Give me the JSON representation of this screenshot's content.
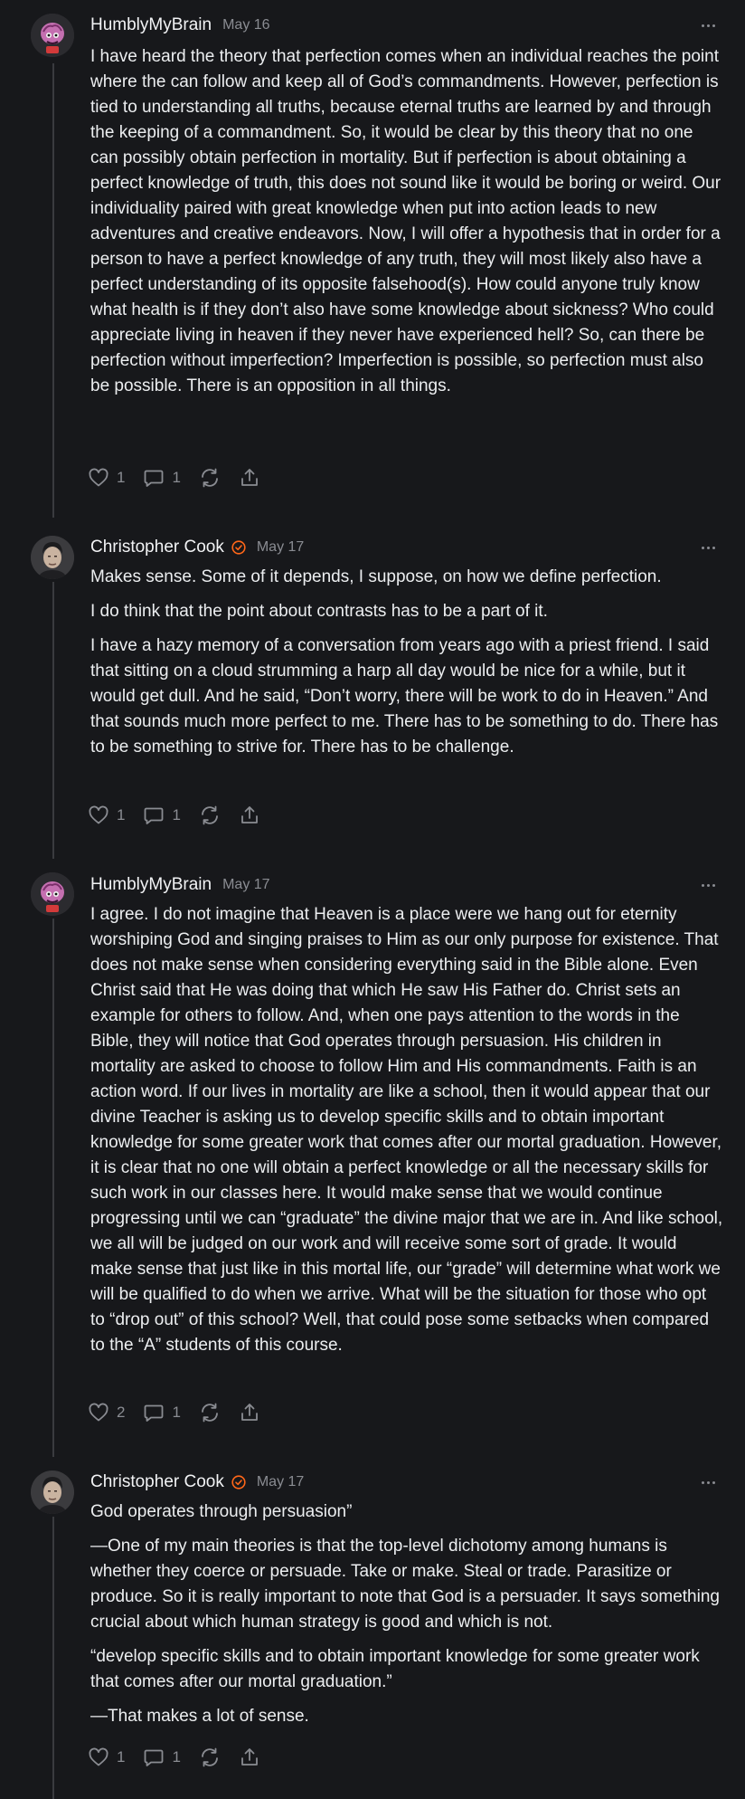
{
  "comments": [
    {
      "author": "HumblyMyBrain",
      "date": "May 16",
      "verified": false,
      "paragraphs": [
        "I have heard the theory that perfection comes when an individual reaches the point where the can follow and keep all of God’s commandments. However, perfection is tied to understanding all truths, because eternal truths are learned by and through the keeping of a commandment. So, it would be clear by this theory that no one can possibly obtain perfection in mortality. But if perfection is about obtaining a perfect knowledge of truth, this does not sound like it would be boring or weird. Our individuality paired with great knowledge when put into action leads to new adventures and creative endeavors. Now, I will offer a hypothesis that in order for a person to have a perfect knowledge of any truth, they will most likely also have a perfect understanding of its opposite falsehood(s). How could anyone truly know what health is if they don’t also have some knowledge about sickness? Who could appreciate living in heaven if they never have experienced hell? So, can there be perfection without imperfection? Imperfection is possible, so perfection must also be possible. There is an opposition in all things."
      ],
      "likes": "1",
      "replies": "1"
    },
    {
      "author": "Christopher Cook",
      "date": "May 17",
      "verified": true,
      "paragraphs": [
        "Makes sense. Some of it depends, I suppose, on how we define perfection.",
        "I do think that the point about contrasts has to be a part of it.",
        "I have a hazy memory of a conversation from years ago with a priest friend. I said that sitting on a cloud strumming a harp all day would be nice for a while, but it would get dull. And he said, “Don’t worry, there will be work to do in Heaven.” And that sounds much more perfect to me. There has to be something to do. There has to be something to strive for. There has to be challenge."
      ],
      "likes": "1",
      "replies": "1"
    },
    {
      "author": "HumblyMyBrain",
      "date": "May 17",
      "verified": false,
      "paragraphs": [
        "I agree. I do not imagine that Heaven is a place were we hang out for eternity worshiping God and singing praises to Him as our only purpose for existence. That does not make sense when considering everything said in the Bible alone. Even Christ said that He was doing that which He saw His Father do. Christ sets an example for others to follow. And, when one pays attention to the words in the Bible, they will notice that God operates through persuasion. His children in mortality are asked to choose to follow Him and His commandments. Faith is an action word. If our lives in mortality are like a school, then it would appear that our divine Teacher is asking us to develop specific skills and to obtain important knowledge for some greater work that comes after our mortal graduation. However, it is clear that no one will obtain a perfect knowledge or all the necessary skills for such work in our classes here. It would make sense that we would continue progressing until we can “graduate” the divine major that we are in. And like school, we all will be judged on our work and will receive some sort of grade. It would make sense that just like in this mortal life, our “grade” will determine what work we will be qualified to do when we arrive. What will be the situation for those who opt to “drop out” of this school? Well, that could pose some setbacks when compared to the “A” students of this course."
      ],
      "likes": "2",
      "replies": "1"
    },
    {
      "author": "Christopher Cook",
      "date": "May 17",
      "verified": true,
      "paragraphs": [
        "God operates through persuasion”",
        "—One of my main theories is that the top-level dichotomy among humans is whether they coerce or persuade. Take or make. Steal or trade. Parasitize or produce. So it is really important to note that God is a persuader. It says something crucial about which human strategy is good and which is not.",
        "“develop specific skills and to obtain important knowledge for some greater work that comes after our mortal graduation.”",
        "—That makes a lot of sense."
      ],
      "likes": "1",
      "replies": "1"
    }
  ],
  "colors": {
    "background": "#17181b",
    "text": "#eceef0",
    "muted": "#8a8c92",
    "thread_line": "#3a3b3f",
    "verified_badge": "#ff6719"
  },
  "icons": [
    "heart-icon",
    "comment-icon",
    "restack-icon",
    "share-icon",
    "more-icon",
    "verified-badge-icon"
  ]
}
